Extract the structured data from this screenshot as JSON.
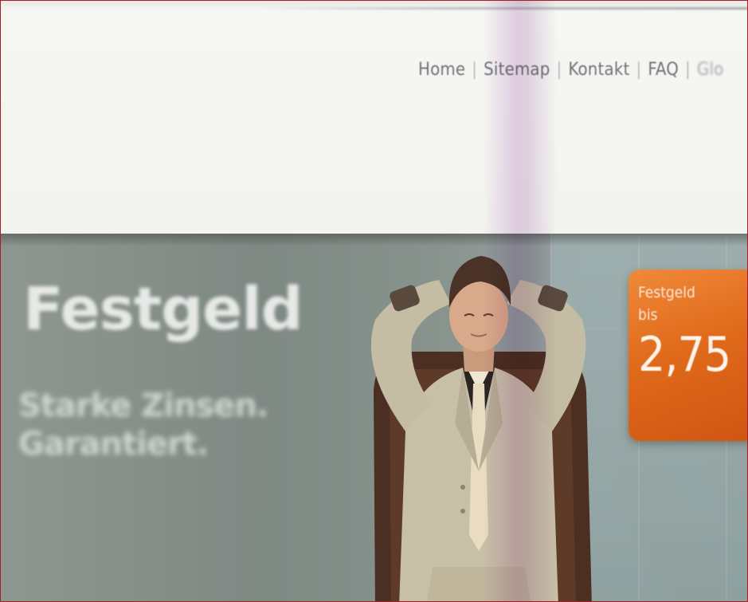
{
  "topnav": {
    "items": [
      "Home",
      "Sitemap",
      "Kontakt",
      "FAQ",
      "Glo"
    ],
    "separator": "|"
  },
  "hero": {
    "title": "Festgeld",
    "subtitle_lines": [
      "Starke Zinsen.",
      "Garantiert."
    ],
    "badge": {
      "line1": "Festgeld",
      "line2": "bis",
      "rate": "2,75"
    }
  },
  "colors": {
    "frame_border": "#a3202a",
    "badge_orange": "#e06a1b",
    "hero_bg": "#869089",
    "nav_text": "#7b7f83"
  }
}
